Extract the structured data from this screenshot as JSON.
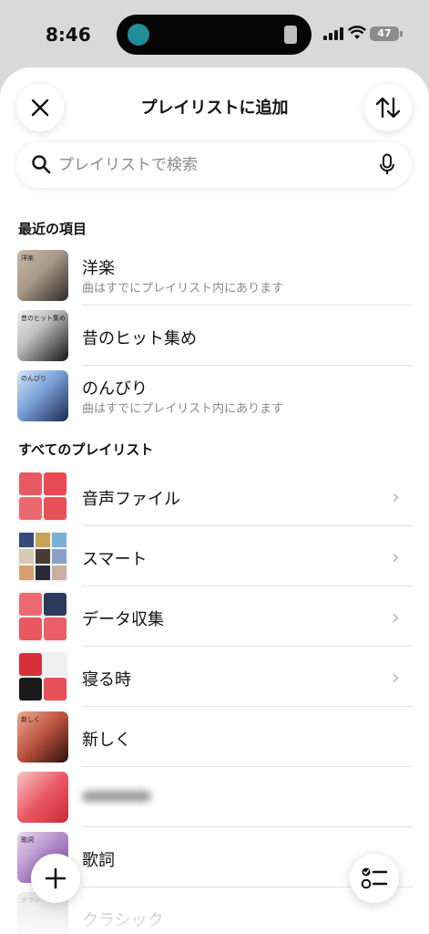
{
  "status_bar": {
    "time": "8:46",
    "battery": "47"
  },
  "sheet": {
    "title": "プレイリストに追加",
    "close_icon": "close-icon",
    "sort_icon": "sort-arrows-icon"
  },
  "search": {
    "placeholder": "プレイリストで検索",
    "value": ""
  },
  "recent": {
    "title": "最近の項目",
    "items": [
      {
        "title": "洋楽",
        "subtitle": "曲はすでにプレイリスト内にあります",
        "art_label": "洋楽"
      },
      {
        "title": "昔のヒット集め",
        "subtitle": "",
        "art_label": "昔のヒット集め"
      },
      {
        "title": "のんびり",
        "subtitle": "曲はすでにプレイリスト内にあります",
        "art_label": "のんびり"
      }
    ]
  },
  "all": {
    "title": "すべてのプレイリスト",
    "items": [
      {
        "title": "音声ファイル",
        "has_chevron": true
      },
      {
        "title": "スマート",
        "has_chevron": true
      },
      {
        "title": "データ収集",
        "has_chevron": true
      },
      {
        "title": "寝る時",
        "has_chevron": true
      },
      {
        "title": "新しく",
        "has_chevron": false,
        "art_label": "新しく"
      },
      {
        "title": "",
        "has_chevron": false
      },
      {
        "title": "歌詞",
        "has_chevron": false,
        "art_label": "歌詞"
      },
      {
        "title": "クラシック",
        "has_chevron": false,
        "art_label": "クラシ"
      }
    ]
  },
  "fab": {
    "add_icon": "plus-icon",
    "edit_icon": "checklist-icon"
  },
  "colors": {
    "accent_red": "#e8555e",
    "sheet_bg": "#ffffff",
    "status_bg": "#d9d9d9"
  }
}
